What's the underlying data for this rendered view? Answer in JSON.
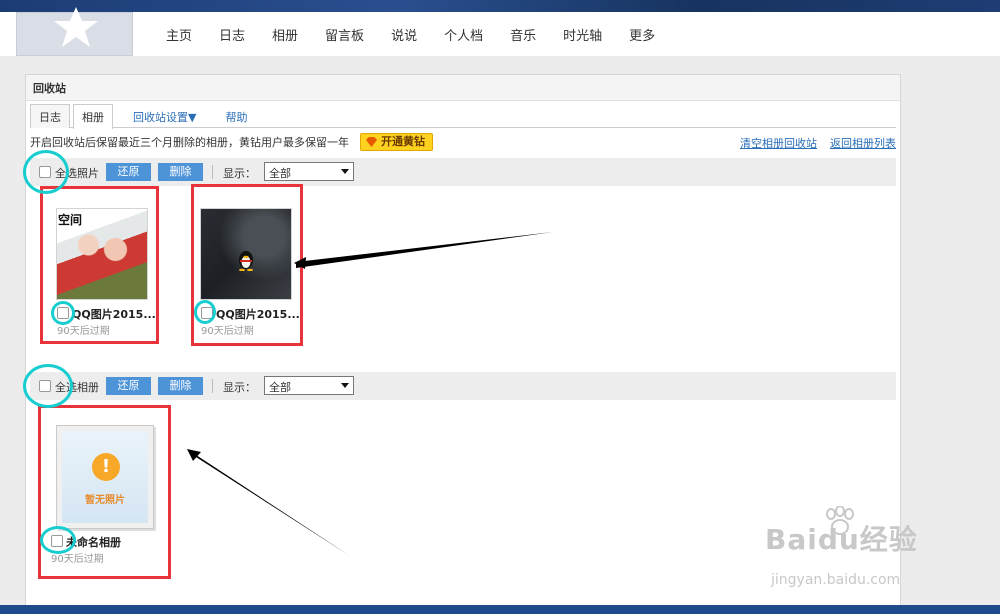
{
  "nav": {
    "items": [
      "主页",
      "日志",
      "相册",
      "留言板",
      "说说",
      "个人档",
      "音乐",
      "时光轴",
      "更多"
    ]
  },
  "panel": {
    "title": "回收站",
    "tabs": [
      "日志",
      "相册",
      "回收站设置▼",
      "帮助"
    ],
    "active_tab": "相册",
    "notice": "开启回收站后保留最近三个月删除的相册，黄钻用户最多保留一年",
    "vip_button": "开通黄钻",
    "links": {
      "clear": "清空相册回收站",
      "back": "返回相册列表"
    }
  },
  "photo_toolbar": {
    "select_all": "全选照片",
    "restore": "还原",
    "delete": "删除",
    "show_label": "显示：",
    "show_value": "全部"
  },
  "photos": [
    {
      "thumb_text": "空间",
      "name": "QQ图片2015...",
      "expire": "90天后过期"
    },
    {
      "name": "QQ图片2015...",
      "expire": "90天后过期"
    }
  ],
  "album_toolbar": {
    "select_all": "全选相册",
    "restore": "还原",
    "delete": "删除",
    "show_label": "显示：",
    "show_value": "全部"
  },
  "albums": [
    {
      "placeholder": "暂无照片",
      "name": "未命名相册",
      "expire": "90天后过期"
    }
  ],
  "watermark": {
    "brand": "Baidu经验",
    "url": "jingyan.baidu.com"
  },
  "colors": {
    "button_blue": "#4d93d8",
    "annotation_red": "#e8333a",
    "annotation_cyan": "#18cdd0",
    "vip_yellow": "#ffd21f"
  }
}
